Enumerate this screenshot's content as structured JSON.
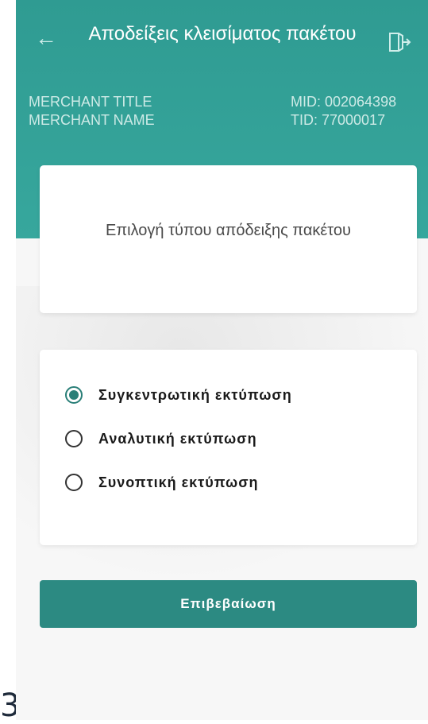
{
  "header": {
    "title": "Αποδείξεις κλεισίματος πακέτου",
    "back_icon": "arrow-left-icon",
    "logout_icon": "logout-icon"
  },
  "merchant": {
    "title": "MERCHANT TITLE",
    "name": "MERCHANT NAME",
    "mid": "MID: 002064398",
    "tid": "TID: 77000017"
  },
  "card": {
    "title": "Επιλογή τύπου απόδειξης πακέτου"
  },
  "options": [
    {
      "label": "Συγκεντρωτική εκτύπωση",
      "selected": true
    },
    {
      "label": "Αναλυτική εκτύπωση",
      "selected": false
    },
    {
      "label": "Συνοπτική εκτύπωση",
      "selected": false
    }
  ],
  "confirm_label": "Επιβεβαίωση",
  "stray_text": "3.",
  "colors": {
    "header": "#2f9b92",
    "accent": "#2c8a82",
    "background": "#f7f7f7"
  }
}
